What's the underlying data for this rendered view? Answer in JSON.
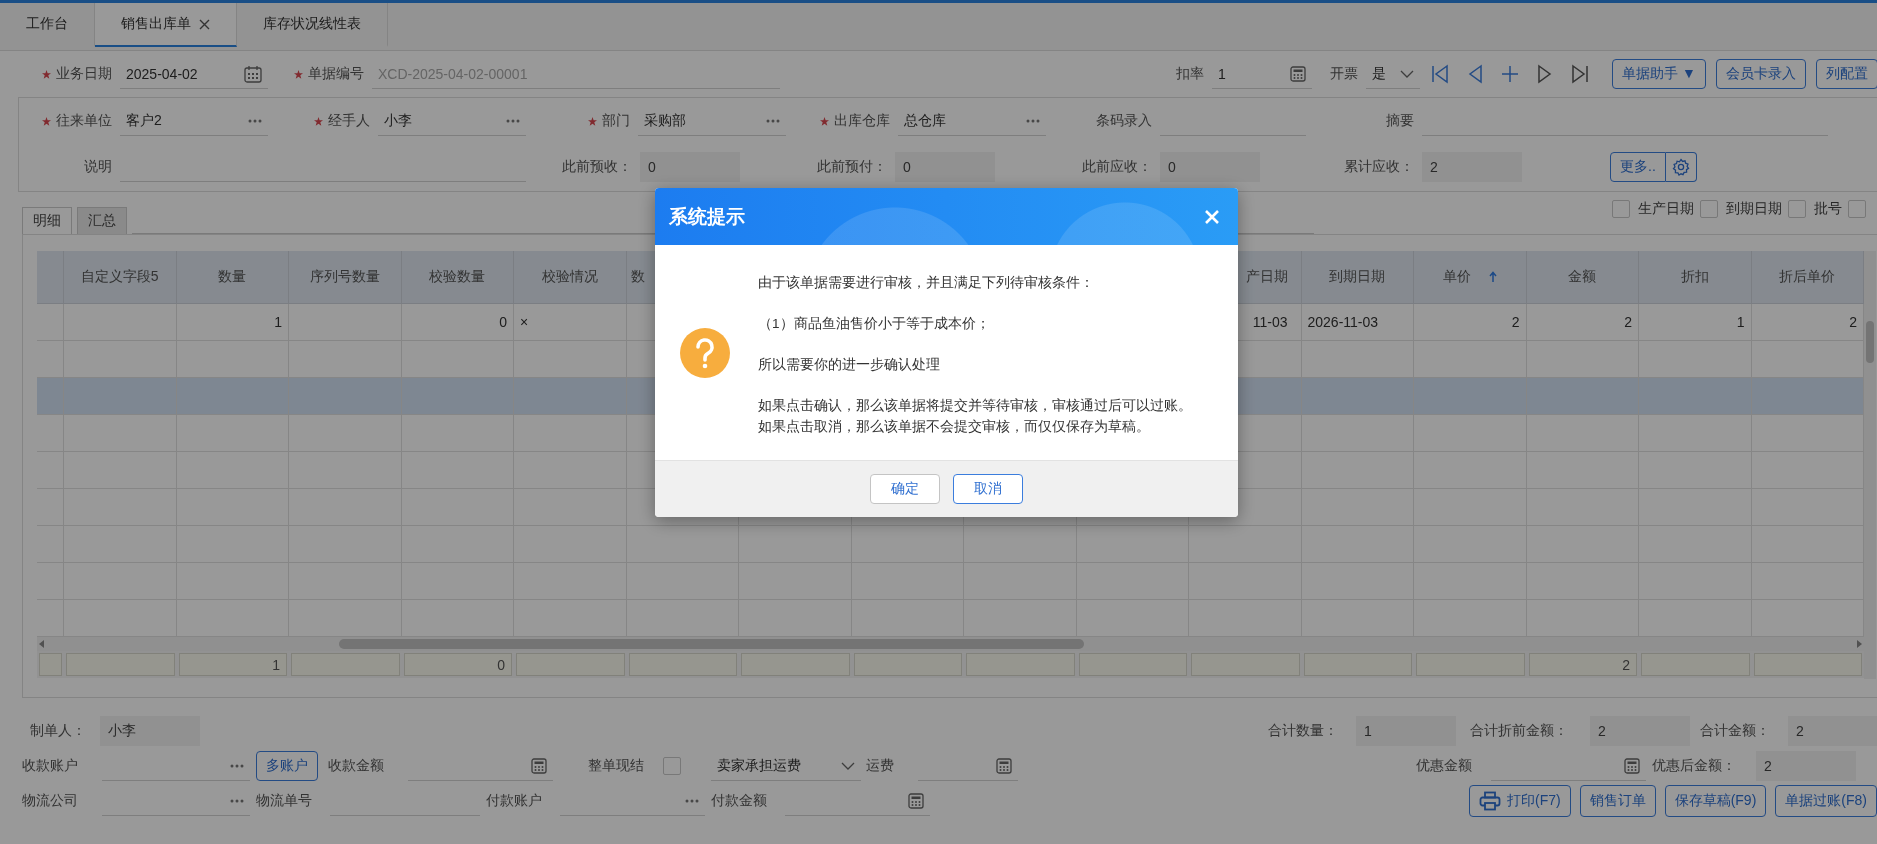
{
  "tabs": [
    {
      "label": "工作台",
      "selected": false,
      "closable": false
    },
    {
      "label": "销售出库单",
      "selected": true,
      "closable": true
    },
    {
      "label": "库存状况线性表",
      "selected": false,
      "closable": false
    }
  ],
  "toolbar": {
    "fields": [
      {
        "kind": "date",
        "label": "业务日期",
        "required": true,
        "value": "2025-04-02",
        "disabled": false
      },
      {
        "kind": "text",
        "label": "单据编号",
        "required": true,
        "value": "XCD-2025-04-02-00001",
        "disabled": true
      }
    ],
    "options": [
      {
        "kind": "calc",
        "label": "扣率",
        "value": "1"
      },
      {
        "kind": "dropdown",
        "label": "开票",
        "value": "是"
      }
    ],
    "buttons": [
      "单据助手 ▼",
      "会员卡录入",
      "列配置"
    ]
  },
  "info": {
    "fields": [
      {
        "kind": "lookup",
        "label": "往来单位",
        "required": true,
        "value": "客户2"
      },
      {
        "kind": "lookup",
        "label": "经手人",
        "required": true,
        "value": "小李"
      },
      {
        "kind": "lookup",
        "label": "部门",
        "required": true,
        "value": "采购部"
      },
      {
        "kind": "lookup",
        "label": "出库仓库",
        "required": true,
        "value": "总仓库"
      },
      {
        "kind": "text",
        "label": "条码录入",
        "required": false
      },
      {
        "kind": "text",
        "label": "摘要",
        "required": false
      },
      {
        "kind": "text",
        "label": "说明",
        "required": false
      },
      {
        "kind": "readonly",
        "label": "此前预收：",
        "required": false,
        "value": "0"
      },
      {
        "kind": "readonly",
        "label": "此前预付：",
        "required": false,
        "value": "0"
      },
      {
        "kind": "readonly",
        "label": "此前应收：",
        "required": false,
        "value": "0"
      },
      {
        "kind": "readonly",
        "label": "累计应收：",
        "required": false,
        "value": "2"
      }
    ],
    "more_button": "更多.."
  },
  "detail_tabs": [
    {
      "label": "明细",
      "selected": false
    },
    {
      "label": "汇总",
      "selected": true
    }
  ],
  "column_options": [
    {
      "label": "生产日期",
      "checked": false
    },
    {
      "label": "到期日期",
      "checked": false
    },
    {
      "label": "批号",
      "checked": false
    },
    {
      "checked": false
    }
  ],
  "table": {
    "columns": [
      {
        "header": "自定义字段5",
        "sorted": false
      },
      {
        "header": "数量",
        "sorted": false,
        "total": "1"
      },
      {
        "header": "序列号数量",
        "sorted": false
      },
      {
        "header": "校验数量",
        "sorted": false,
        "total": "0"
      },
      {
        "header": "校验情况",
        "sorted": false
      },
      {
        "header": "数",
        "sorted": false
      },
      {},
      {},
      {},
      {},
      {
        "header": "产日期",
        "sorted": false
      },
      {
        "header": "到期日期",
        "sorted": false
      },
      {
        "header": "单价",
        "sorted": true
      },
      {
        "header": "金额",
        "sorted": false,
        "total": "2"
      },
      {
        "header": "折扣",
        "sorted": false
      },
      {
        "header": "折后单价",
        "sorted": false
      }
    ],
    "rows": [
      {
        "selected": false,
        "cells": [
          "",
          "1",
          "",
          "0",
          "×",
          "",
          "",
          "",
          "",
          "",
          "11-03",
          "2026-11-03",
          "2",
          "2",
          "1",
          "2"
        ]
      },
      {
        "selected": false,
        "cells": []
      },
      {
        "selected": true,
        "cells": []
      },
      {
        "selected": false,
        "cells": []
      },
      {
        "selected": false,
        "cells": []
      },
      {
        "selected": false,
        "cells": []
      },
      {
        "selected": false,
        "cells": []
      },
      {
        "selected": false,
        "cells": []
      },
      {
        "selected": false,
        "cells": []
      }
    ]
  },
  "footer": {
    "creator": {
      "label": "制单人：",
      "value": "小李"
    },
    "totals": [
      {
        "label": "合计数量：",
        "value": "1"
      },
      {
        "label": "合计折前金额：",
        "value": "2"
      },
      {
        "label": "合计金额：",
        "value": "2"
      }
    ],
    "payment_row": [
      {
        "kind": "lookup",
        "label": "收款账户"
      },
      {
        "kind": "button",
        "label": "多账户"
      },
      {
        "kind": "calc",
        "label": "收款金额"
      },
      {
        "kind": "checkbox",
        "label": "整单现结",
        "checked": false
      },
      {
        "kind": "select",
        "value": "卖家承担运费"
      },
      {
        "kind": "calc",
        "label": "运费"
      }
    ],
    "discount": [
      {
        "kind": "calc",
        "label": "优惠金额"
      },
      {
        "kind": "readonly",
        "label": "优惠后金额：",
        "value": "2"
      }
    ],
    "logistics_row": [
      {
        "kind": "lookup",
        "label": "物流公司"
      },
      {
        "kind": "text",
        "label": "物流单号"
      },
      {
        "kind": "lookup",
        "label": "付款账户"
      },
      {
        "kind": "calc",
        "label": "付款金额"
      }
    ],
    "actions": [
      "打印(F7)",
      "销售订单",
      "保存草稿(F9)",
      "单据过账(F8)"
    ]
  },
  "dialog": {
    "title": "系统提示",
    "paragraphs": [
      [
        "由于该单据需要进行审核，并且满足下列待审核条件："
      ],
      [
        "（1）商品鱼油售价小于等于成本价；"
      ],
      [
        "所以需要你的进一步确认处理"
      ],
      [
        "如果点击确认，那么该单据将提交并等待审核，审核通过后可以过账。",
        "如果点击取消，那么该单据不会提交审核，而仅仅保存为草稿。"
      ]
    ],
    "buttons": [
      "确定",
      "取消"
    ]
  }
}
